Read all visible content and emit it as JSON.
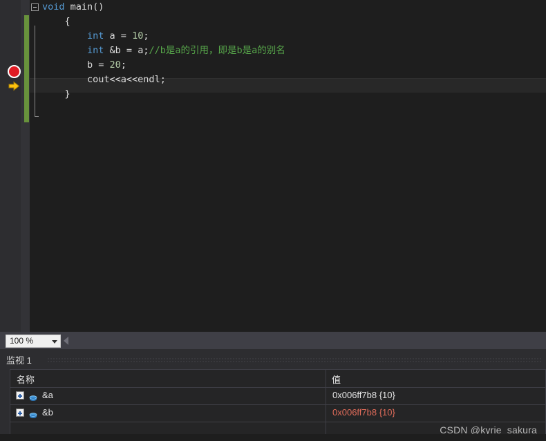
{
  "editor": {
    "lines": [
      {
        "id": "l1",
        "indent": 0,
        "tokens": [
          {
            "t": "void",
            "c": "kw"
          },
          {
            "t": " main()",
            "c": "pl"
          }
        ]
      },
      {
        "id": "l2",
        "indent": 1,
        "tokens": [
          {
            "t": "{",
            "c": "pl"
          }
        ]
      },
      {
        "id": "l3",
        "indent": 2,
        "tokens": [
          {
            "t": "int",
            "c": "kw"
          },
          {
            "t": " a = ",
            "c": "pl"
          },
          {
            "t": "10",
            "c": "num"
          },
          {
            "t": ";",
            "c": "pl"
          }
        ]
      },
      {
        "id": "l4",
        "indent": 2,
        "tokens": [
          {
            "t": "int",
            "c": "kw"
          },
          {
            "t": " &b = a;",
            "c": "pl"
          },
          {
            "t": "//b是a的引用，即是b是a的别名",
            "c": "cmt"
          }
        ]
      },
      {
        "id": "l5",
        "indent": 2,
        "tokens": [
          {
            "t": "b = ",
            "c": "pl"
          },
          {
            "t": "20",
            "c": "num"
          },
          {
            "t": ";",
            "c": "pl"
          }
        ]
      },
      {
        "id": "l6",
        "indent": 2,
        "tokens": [
          {
            "t": "cout<<a<<endl;",
            "c": "pl"
          }
        ]
      },
      {
        "id": "l7",
        "indent": 1,
        "tokens": [
          {
            "t": "}",
            "c": "pl"
          }
        ]
      }
    ],
    "current_line_index": 4,
    "breakpoint_line_index": 3,
    "fold_state": "expanded",
    "colors": {
      "background": "#1e1e1e",
      "keyword": "#569cd6",
      "number": "#b5cea8",
      "comment": "#57a64a",
      "plain": "#dcdcdc",
      "change_bar": "#68923c",
      "breakpoint": "#e01b24",
      "current_statement_arrow": "#ffc20e",
      "current_line_highlight": "#282828"
    }
  },
  "zoom_bar": {
    "zoom_value": "100 %",
    "dropdown_icon": "chevron-down-icon",
    "scroll_left_icon": "triangle-left-icon"
  },
  "watch_panel": {
    "title": "监视 1",
    "columns": [
      "名称",
      "值"
    ],
    "rows": [
      {
        "expander": "+",
        "icon": "cylinder-icon",
        "name": "&a",
        "value": "0x006ff7b8 {10}",
        "changed": false
      },
      {
        "expander": "+",
        "icon": "cylinder-icon",
        "name": "&b",
        "value": "0x006ff7b8 {10}",
        "changed": true
      },
      {
        "expander": "",
        "icon": "",
        "name": "",
        "value": "",
        "changed": false
      }
    ],
    "changed_value_color": "#e06c5a"
  },
  "watermark": {
    "text": "CSDN @kyrie_sakura"
  }
}
